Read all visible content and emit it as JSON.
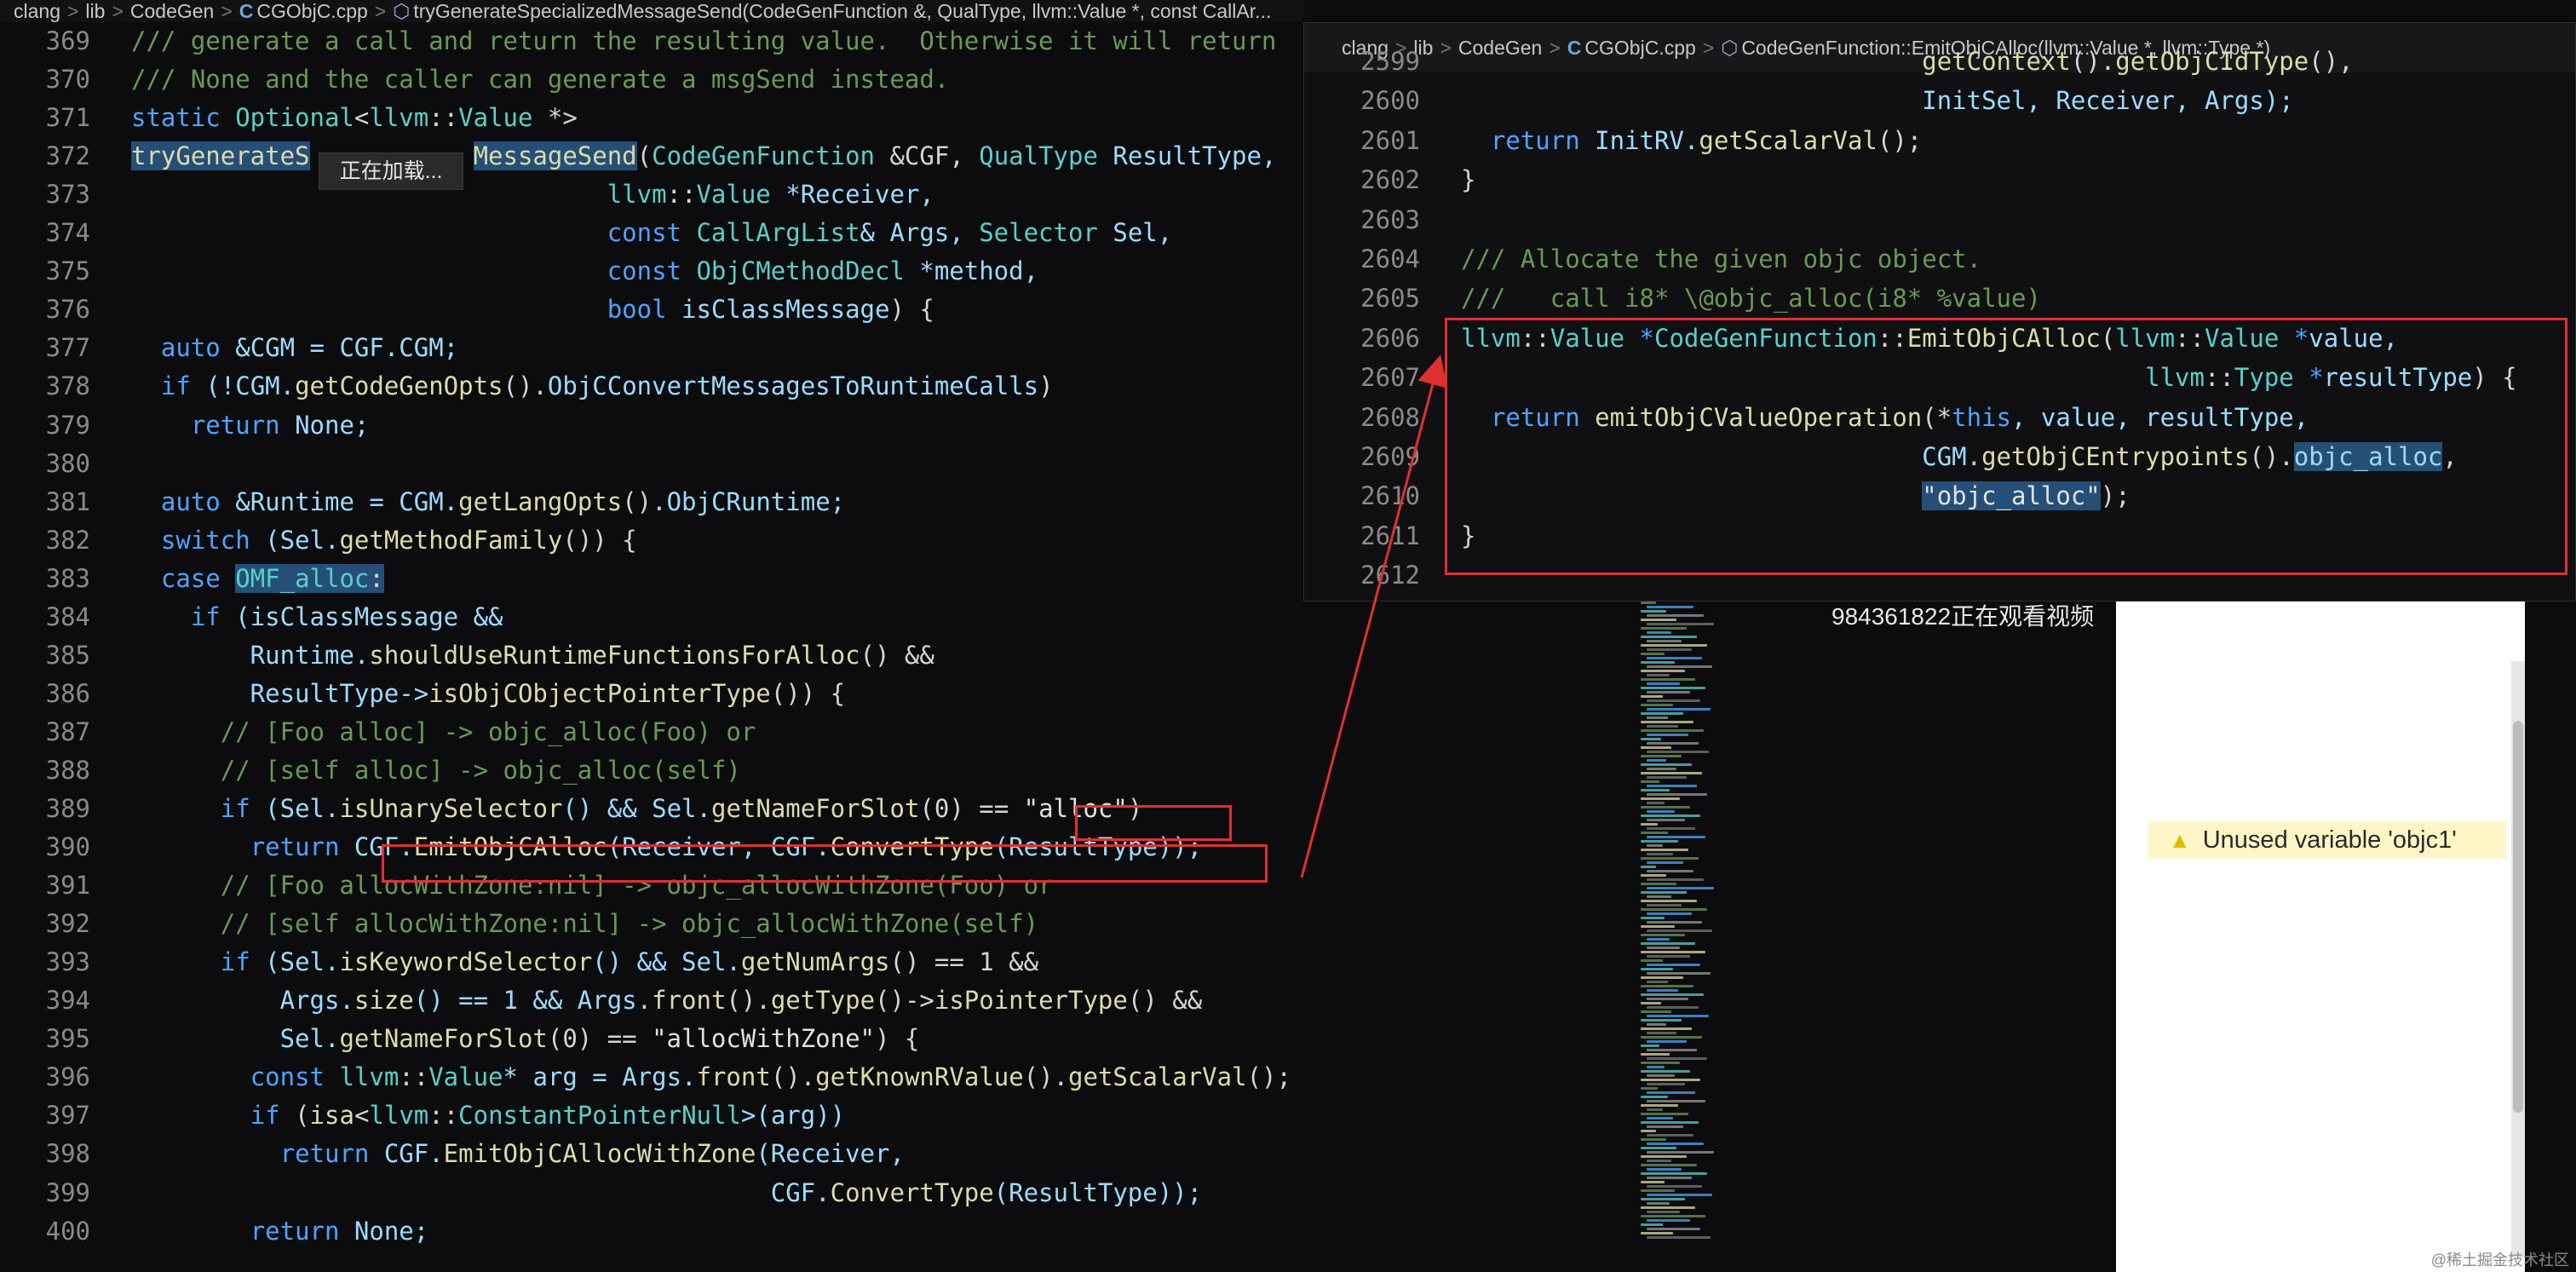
{
  "breadcrumb_main": {
    "items": [
      "clang",
      "lib",
      "CodeGen",
      "CGObjC.cpp",
      "tryGenerateSpecializedMessageSend(CodeGenFunction &, QualType, llvm::Value *, const CallAr..."
    ]
  },
  "loading_tooltip": "正在加载...",
  "main_editor": {
    "lines": [
      {
        "n": "369",
        "segs": [
          {
            "t": "/// generate a call and return the resulting value.  Otherwise it will return",
            "c": "com"
          }
        ]
      },
      {
        "n": "370",
        "segs": [
          {
            "t": "/// None and the caller can generate a msgSend instead.",
            "c": "com"
          }
        ]
      },
      {
        "n": "371",
        "segs": [
          {
            "t": "static ",
            "c": "kw"
          },
          {
            "t": "Optional",
            "c": "type"
          },
          {
            "t": "<",
            "c": ""
          },
          {
            "t": "llvm",
            "c": "type"
          },
          {
            "t": "::",
            "c": ""
          },
          {
            "t": "Value",
            "c": "type"
          },
          {
            "t": " *>",
            "c": ""
          }
        ]
      },
      {
        "n": "372",
        "segs": [
          {
            "t": "tryGenerateS",
            "c": "fnhl"
          },
          {
            "t": "           ",
            "c": ""
          },
          {
            "t": "MessageSend",
            "c": "fnhl"
          },
          {
            "t": "(",
            "c": ""
          },
          {
            "t": "CodeGenFunction",
            "c": "type"
          },
          {
            "t": " &CGF, ",
            "c": ""
          },
          {
            "t": "QualType",
            "c": "type"
          },
          {
            "t": " ResultType,",
            "c": "var"
          }
        ]
      },
      {
        "n": "373",
        "segs": [
          {
            "t": "                                ",
            "c": ""
          },
          {
            "t": "llvm",
            "c": "type"
          },
          {
            "t": "::",
            "c": ""
          },
          {
            "t": "Value",
            "c": "type"
          },
          {
            "t": " *Receiver,",
            "c": "var"
          }
        ]
      },
      {
        "n": "374",
        "segs": [
          {
            "t": "                                ",
            "c": ""
          },
          {
            "t": "const ",
            "c": "kw"
          },
          {
            "t": "CallArgList",
            "c": "type"
          },
          {
            "t": "& Args, ",
            "c": "var"
          },
          {
            "t": "Selector",
            "c": "type"
          },
          {
            "t": " Sel,",
            "c": "var"
          }
        ]
      },
      {
        "n": "375",
        "segs": [
          {
            "t": "                                ",
            "c": ""
          },
          {
            "t": "const ",
            "c": "kw"
          },
          {
            "t": "ObjCMethodDecl",
            "c": "type"
          },
          {
            "t": " *method,",
            "c": "var"
          }
        ]
      },
      {
        "n": "376",
        "segs": [
          {
            "t": "                                ",
            "c": ""
          },
          {
            "t": "bool ",
            "c": "kw"
          },
          {
            "t": "isClassMessage",
            "c": "var"
          },
          {
            "t": ") {",
            "c": ""
          }
        ]
      },
      {
        "n": "377",
        "segs": [
          {
            "t": "  ",
            "c": ""
          },
          {
            "t": "auto ",
            "c": "kw"
          },
          {
            "t": "&CGM = CGF.CGM;",
            "c": "var"
          }
        ]
      },
      {
        "n": "378",
        "segs": [
          {
            "t": "  ",
            "c": ""
          },
          {
            "t": "if ",
            "c": "kw"
          },
          {
            "t": "(!CGM.",
            "c": "var"
          },
          {
            "t": "getCodeGenOpts",
            "c": "fn"
          },
          {
            "t": "().",
            "c": ""
          },
          {
            "t": "ObjCConvertMessagesToRuntimeCalls",
            "c": "var"
          },
          {
            "t": ")",
            "c": ""
          }
        ]
      },
      {
        "n": "379",
        "segs": [
          {
            "t": "    ",
            "c": ""
          },
          {
            "t": "return ",
            "c": "kw"
          },
          {
            "t": "None;",
            "c": "var"
          }
        ]
      },
      {
        "n": "380",
        "segs": []
      },
      {
        "n": "381",
        "segs": [
          {
            "t": "  ",
            "c": ""
          },
          {
            "t": "auto ",
            "c": "kw"
          },
          {
            "t": "&Runtime = CGM.",
            "c": "var"
          },
          {
            "t": "getLangOpts",
            "c": "fn"
          },
          {
            "t": "().",
            "c": ""
          },
          {
            "t": "ObjCRuntime;",
            "c": "var"
          }
        ]
      },
      {
        "n": "382",
        "segs": [
          {
            "t": "  ",
            "c": ""
          },
          {
            "t": "switch ",
            "c": "kw"
          },
          {
            "t": "(Sel.",
            "c": "var"
          },
          {
            "t": "getMethodFamily",
            "c": "fn"
          },
          {
            "t": "()) {",
            "c": ""
          }
        ]
      },
      {
        "n": "383",
        "segs": [
          {
            "t": "  ",
            "c": ""
          },
          {
            "t": "case ",
            "c": "kw"
          },
          {
            "t": "OMF_alloc",
            "c": "typehl"
          },
          {
            "t": ":",
            "c": "hl"
          }
        ]
      },
      {
        "n": "384",
        "segs": [
          {
            "t": "    ",
            "c": ""
          },
          {
            "t": "if ",
            "c": "kw"
          },
          {
            "t": "(isClassMessage &&",
            "c": "var"
          }
        ]
      },
      {
        "n": "385",
        "segs": [
          {
            "t": "        Runtime.",
            "c": "var"
          },
          {
            "t": "shouldUseRuntimeFunctionsForAlloc",
            "c": "fn"
          },
          {
            "t": "() &&",
            "c": ""
          }
        ]
      },
      {
        "n": "386",
        "segs": [
          {
            "t": "        ResultType->",
            "c": "var"
          },
          {
            "t": "isObjCObjectPointerType",
            "c": "fn"
          },
          {
            "t": "()) {",
            "c": ""
          }
        ]
      },
      {
        "n": "387",
        "segs": [
          {
            "t": "      // [Foo alloc] -> objc_alloc(Foo) or",
            "c": "com"
          }
        ]
      },
      {
        "n": "388",
        "segs": [
          {
            "t": "      // [self alloc] -> objc_alloc(self)",
            "c": "com"
          }
        ]
      },
      {
        "n": "389",
        "segs": [
          {
            "t": "      ",
            "c": ""
          },
          {
            "t": "if ",
            "c": "kw"
          },
          {
            "t": "(Sel.",
            "c": "var"
          },
          {
            "t": "isUnarySelector",
            "c": "fn"
          },
          {
            "t": "() && Sel.",
            "c": "var"
          },
          {
            "t": "getNameForSlot",
            "c": "fn"
          },
          {
            "t": "(0) == ",
            "c": ""
          },
          {
            "t": "\"alloc\"",
            "c": "str"
          },
          {
            "t": ")",
            "c": ""
          }
        ]
      },
      {
        "n": "390",
        "segs": [
          {
            "t": "        ",
            "c": ""
          },
          {
            "t": "return ",
            "c": "kw"
          },
          {
            "t": "CGF.",
            "c": "var"
          },
          {
            "t": "EmitObjCAlloc",
            "c": "fn"
          },
          {
            "t": "(Receiver, CGF.",
            "c": "var"
          },
          {
            "t": "ConvertType",
            "c": "fn"
          },
          {
            "t": "(ResultType));",
            "c": "var"
          }
        ]
      },
      {
        "n": "391",
        "segs": [
          {
            "t": "      // [Foo allocWithZone:nil] -> objc_allocWithZone(Foo) or",
            "c": "com"
          }
        ]
      },
      {
        "n": "392",
        "segs": [
          {
            "t": "      // [self allocWithZone:nil] -> objc_allocWithZone(self)",
            "c": "com"
          }
        ]
      },
      {
        "n": "393",
        "segs": [
          {
            "t": "      ",
            "c": ""
          },
          {
            "t": "if ",
            "c": "kw"
          },
          {
            "t": "(Sel.",
            "c": "var"
          },
          {
            "t": "isKeywordSelector",
            "c": "fn"
          },
          {
            "t": "() && Sel.",
            "c": "var"
          },
          {
            "t": "getNumArgs",
            "c": "fn"
          },
          {
            "t": "() == 1 &&",
            "c": ""
          }
        ]
      },
      {
        "n": "394",
        "segs": [
          {
            "t": "          Args.",
            "c": "var"
          },
          {
            "t": "size",
            "c": "fn"
          },
          {
            "t": "() == 1 && Args.",
            "c": "var"
          },
          {
            "t": "front",
            "c": "fn"
          },
          {
            "t": "().",
            "c": ""
          },
          {
            "t": "getType",
            "c": "fn"
          },
          {
            "t": "()->",
            "c": ""
          },
          {
            "t": "isPointerType",
            "c": "fn"
          },
          {
            "t": "() &&",
            "c": ""
          }
        ]
      },
      {
        "n": "395",
        "segs": [
          {
            "t": "          Sel.",
            "c": "var"
          },
          {
            "t": "getNameForSlot",
            "c": "fn"
          },
          {
            "t": "(0) == ",
            "c": ""
          },
          {
            "t": "\"allocWithZone\"",
            "c": "str"
          },
          {
            "t": ") {",
            "c": ""
          }
        ]
      },
      {
        "n": "396",
        "segs": [
          {
            "t": "        ",
            "c": ""
          },
          {
            "t": "const ",
            "c": "kw"
          },
          {
            "t": "llvm",
            "c": "type"
          },
          {
            "t": "::",
            "c": ""
          },
          {
            "t": "Value",
            "c": "type"
          },
          {
            "t": "* arg = Args.",
            "c": "var"
          },
          {
            "t": "front",
            "c": "fn"
          },
          {
            "t": "().",
            "c": ""
          },
          {
            "t": "getKnownRValue",
            "c": "fn"
          },
          {
            "t": "().",
            "c": ""
          },
          {
            "t": "getScalarVal",
            "c": "fn"
          },
          {
            "t": "();",
            "c": ""
          }
        ]
      },
      {
        "n": "397",
        "segs": [
          {
            "t": "        ",
            "c": ""
          },
          {
            "t": "if ",
            "c": "kw"
          },
          {
            "t": "(",
            "c": ""
          },
          {
            "t": "isa",
            "c": "fn"
          },
          {
            "t": "<",
            "c": ""
          },
          {
            "t": "llvm",
            "c": "type"
          },
          {
            "t": "::",
            "c": ""
          },
          {
            "t": "ConstantPointerNull",
            "c": "type"
          },
          {
            "t": ">(arg))",
            "c": "var"
          }
        ]
      },
      {
        "n": "398",
        "segs": [
          {
            "t": "          ",
            "c": ""
          },
          {
            "t": "return ",
            "c": "kw"
          },
          {
            "t": "CGF.",
            "c": "var"
          },
          {
            "t": "EmitObjCAllocWithZone",
            "c": "fn"
          },
          {
            "t": "(Receiver,",
            "c": "var"
          }
        ]
      },
      {
        "n": "399",
        "segs": [
          {
            "t": "                                           CGF.",
            "c": "var"
          },
          {
            "t": "ConvertType",
            "c": "fn"
          },
          {
            "t": "(ResultType));",
            "c": "var"
          }
        ]
      },
      {
        "n": "400",
        "segs": [
          {
            "t": "        ",
            "c": ""
          },
          {
            "t": "return ",
            "c": "kw"
          },
          {
            "t": "None;",
            "c": "var"
          }
        ]
      }
    ]
  },
  "peek": {
    "breadcrumb": [
      "clang",
      "lib",
      "CodeGen",
      "CGObjC.cpp",
      "CodeGenFunction::EmitObjCAlloc(llvm::Value *, llvm::Type *)"
    ],
    "lines": [
      {
        "n": "2599",
        "segs": [
          {
            "t": "                               ",
            "c": ""
          },
          {
            "t": "getContext",
            "c": "fn"
          },
          {
            "t": "().",
            "c": ""
          },
          {
            "t": "getObjCIdType",
            "c": "fn"
          },
          {
            "t": "(),",
            "c": ""
          }
        ]
      },
      {
        "n": "2600",
        "segs": [
          {
            "t": "                               InitSel, Receiver, Args);",
            "c": "var"
          }
        ]
      },
      {
        "n": "2601",
        "segs": [
          {
            "t": "  ",
            "c": ""
          },
          {
            "t": "return ",
            "c": "kw"
          },
          {
            "t": "InitRV.",
            "c": "var"
          },
          {
            "t": "getScalarVal",
            "c": "fn"
          },
          {
            "t": "();",
            "c": ""
          }
        ]
      },
      {
        "n": "2602",
        "segs": [
          {
            "t": "}",
            "c": ""
          }
        ]
      },
      {
        "n": "2603",
        "segs": []
      },
      {
        "n": "2604",
        "segs": [
          {
            "t": "/// Allocate the given objc object.",
            "c": "com"
          }
        ]
      },
      {
        "n": "2605",
        "segs": [
          {
            "t": "///   call i8* \\@objc_alloc(i8* %value)",
            "c": "com"
          }
        ]
      },
      {
        "n": "2606",
        "segs": [
          {
            "t": "llvm",
            "c": "type"
          },
          {
            "t": "::",
            "c": ""
          },
          {
            "t": "Value",
            "c": "type"
          },
          {
            "t": " *",
            "c": "kw"
          },
          {
            "t": "CodeGenFunction",
            "c": "type"
          },
          {
            "t": "::",
            "c": ""
          },
          {
            "t": "EmitObjCAlloc",
            "c": "fn"
          },
          {
            "t": "(",
            "c": ""
          },
          {
            "t": "llvm",
            "c": "type"
          },
          {
            "t": "::",
            "c": ""
          },
          {
            "t": "Value",
            "c": "type"
          },
          {
            "t": " *",
            "c": "kw"
          },
          {
            "t": "value,",
            "c": "var"
          }
        ]
      },
      {
        "n": "2607",
        "segs": [
          {
            "t": "                                              ",
            "c": ""
          },
          {
            "t": "llvm",
            "c": "type"
          },
          {
            "t": "::",
            "c": ""
          },
          {
            "t": "Type",
            "c": "type"
          },
          {
            "t": " *",
            "c": "kw"
          },
          {
            "t": "resultType",
            "c": "var"
          },
          {
            "t": ") {",
            "c": ""
          }
        ]
      },
      {
        "n": "2608",
        "segs": [
          {
            "t": "  ",
            "c": ""
          },
          {
            "t": "return ",
            "c": "kw"
          },
          {
            "t": "emitObjCValueOperation",
            "c": "fn"
          },
          {
            "t": "(*",
            "c": ""
          },
          {
            "t": "this",
            "c": "kw"
          },
          {
            "t": ", value, resultType,",
            "c": "var"
          }
        ]
      },
      {
        "n": "2609",
        "segs": [
          {
            "t": "                               CGM.",
            "c": "var"
          },
          {
            "t": "getObjCEntrypoints",
            "c": "fn"
          },
          {
            "t": "().",
            "c": ""
          },
          {
            "t": "objc_alloc",
            "c": "varhl"
          },
          {
            "t": ",",
            "c": ""
          }
        ]
      },
      {
        "n": "2610",
        "segs": [
          {
            "t": "                               ",
            "c": ""
          },
          {
            "t": "\"objc_alloc\"",
            "c": "strhl"
          },
          {
            "t": ");",
            "c": ""
          }
        ]
      },
      {
        "n": "2611",
        "segs": [
          {
            "t": "}",
            "c": ""
          }
        ]
      },
      {
        "n": "2612",
        "segs": []
      }
    ]
  },
  "viewer_text": "984361822正在观看视频",
  "warning_text": "Unused variable 'objc1'",
  "watermark": "@稀土掘金技术社区",
  "colors": {
    "annotation_red": "#e03030",
    "selection": "#264f78",
    "warning_bg": "#fff6c7"
  },
  "icons": {
    "file": "cpp-file-icon",
    "symbol": "cube-icon",
    "warning": "warning-icon"
  }
}
